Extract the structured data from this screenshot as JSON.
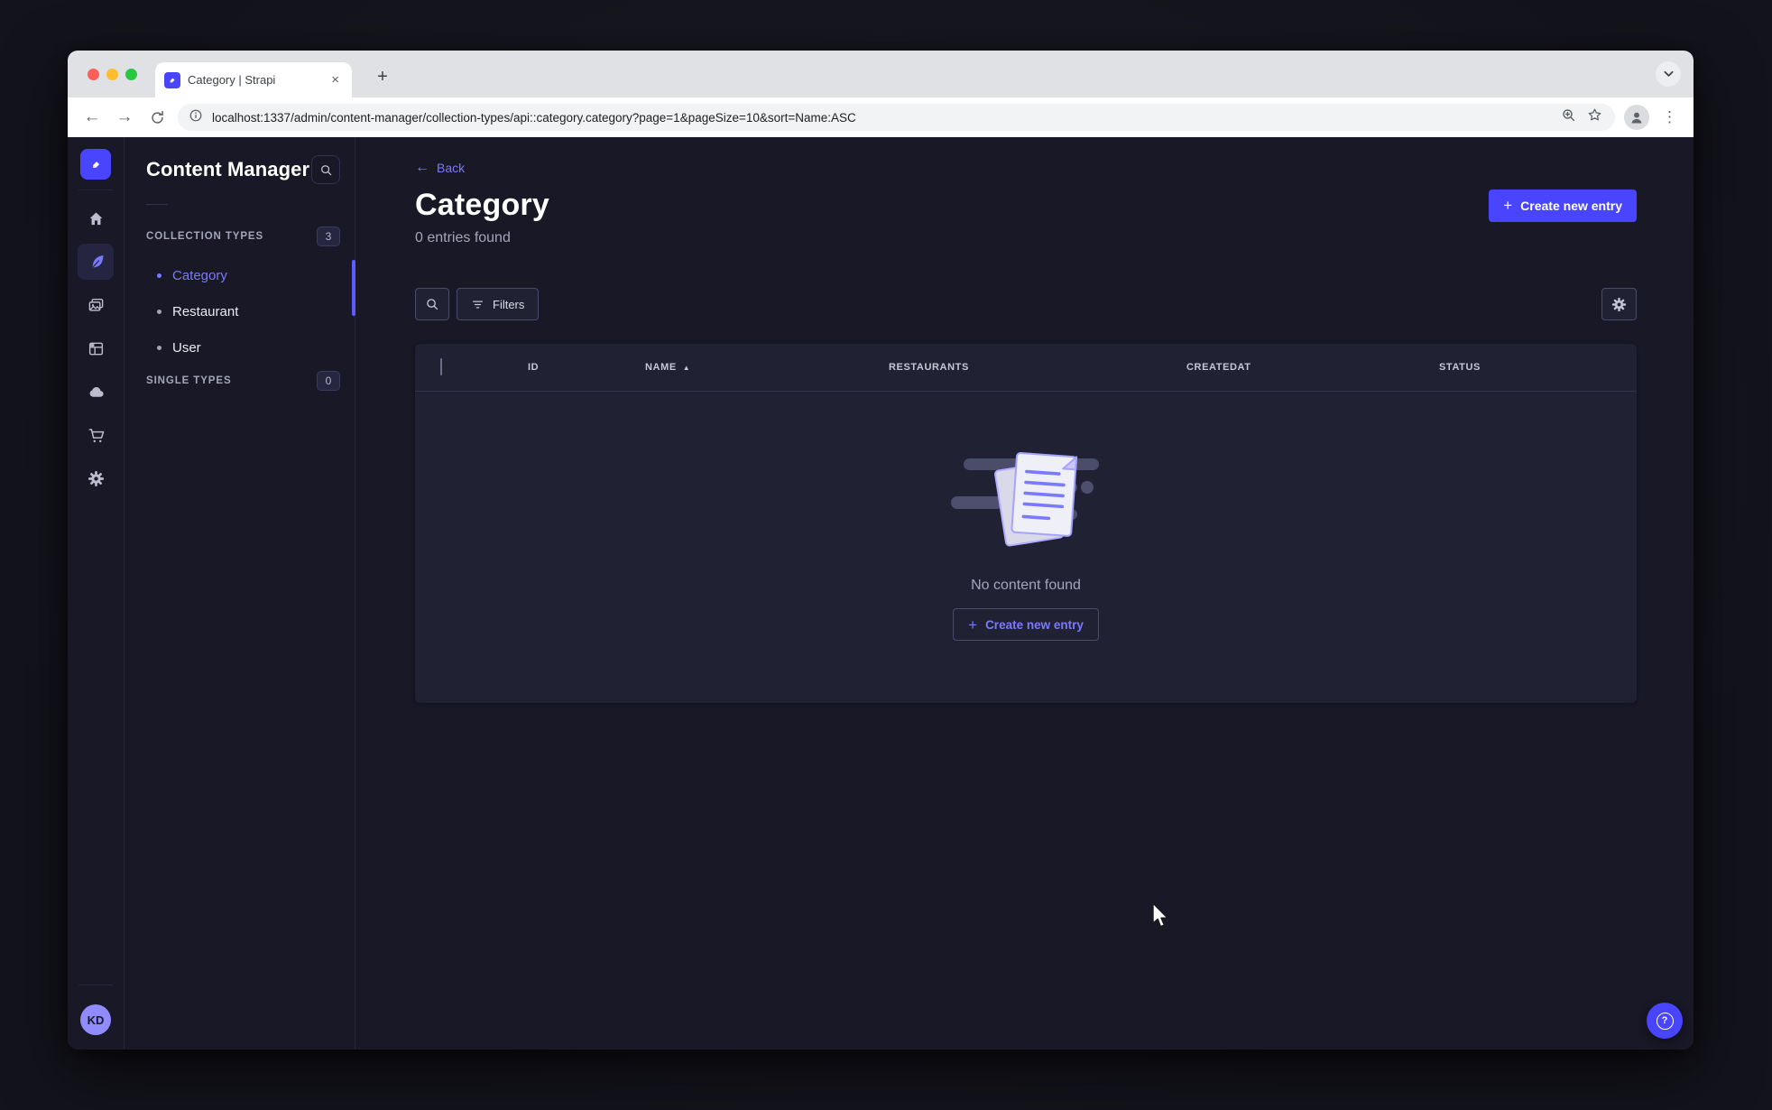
{
  "browser": {
    "tab_title": "Category | Strapi",
    "url": "localhost:1337/admin/content-manager/collection-types/api::category.category?page=1&pageSize=10&sort=Name:ASC"
  },
  "icons": {
    "close": "×",
    "new_tab": "+",
    "back_arrow": "←",
    "forward_arrow": "→",
    "overflow_dots": "⋮",
    "plus": "+",
    "question": "?",
    "sort_asc": "▲"
  },
  "colors": {
    "primary": "#4945ff",
    "primary_light": "#7b79ff",
    "app_background": "#181826",
    "card_background": "#212134",
    "traffic_red": "#ff5f57",
    "traffic_yellow": "#febc2e",
    "traffic_green": "#28c840"
  },
  "rail": {
    "user_initials": "KD"
  },
  "subnav": {
    "title": "Content Manager",
    "sections": [
      {
        "label": "Collection Types",
        "badge": "3",
        "items": [
          {
            "label": "Category",
            "active": true
          },
          {
            "label": "Restaurant",
            "active": false
          },
          {
            "label": "User",
            "active": false
          }
        ]
      },
      {
        "label": "Single Types",
        "badge": "0",
        "items": []
      }
    ]
  },
  "main": {
    "back_label": "Back",
    "title": "Category",
    "subtitle": "0 entries found",
    "create_button_label": "Create new entry",
    "filters_button_label": "Filters",
    "table": {
      "columns": [
        "ID",
        "NAME",
        "RESTAURANTS",
        "CREATEDAT",
        "STATUS"
      ],
      "sorted_column": "NAME",
      "sort_direction": "asc",
      "rows": []
    },
    "empty_state": {
      "message": "No content found",
      "create_button_label": "Create new entry"
    }
  }
}
